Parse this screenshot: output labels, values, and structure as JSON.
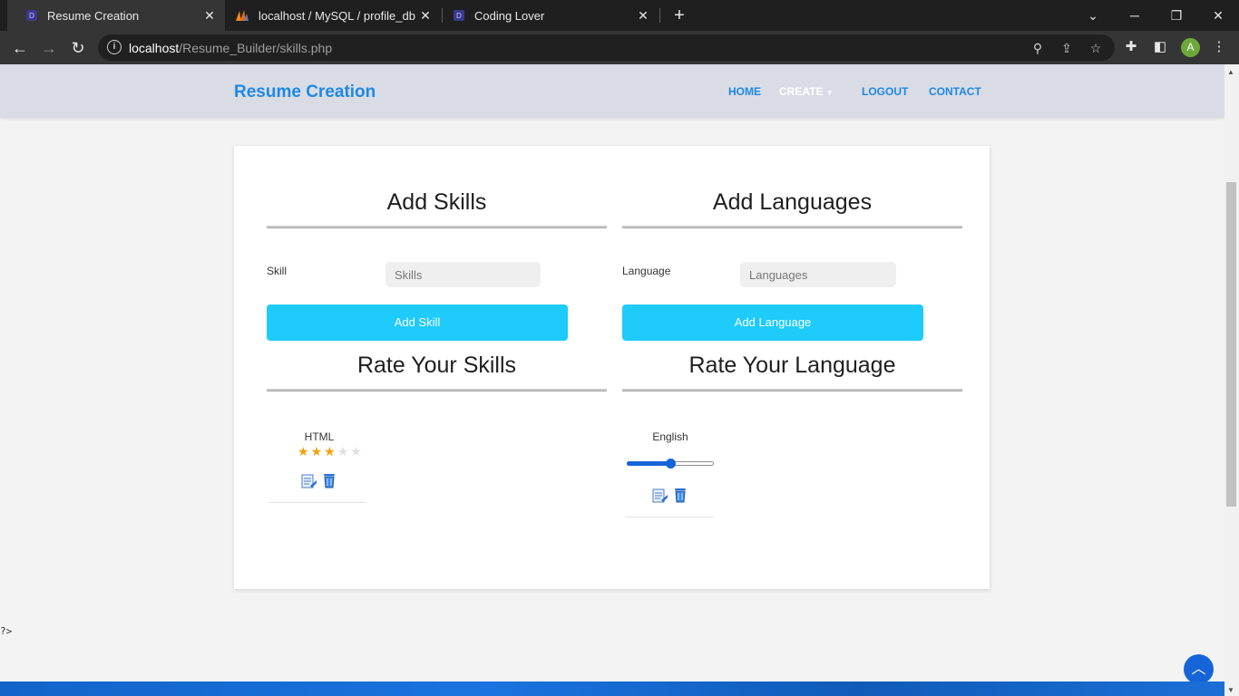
{
  "browser": {
    "tabs": [
      {
        "title": "Resume Creation",
        "active": true,
        "icon": "site-favicon"
      },
      {
        "title": "localhost / MySQL / profile_db / c",
        "active": false,
        "icon": "phpmyadmin-favicon"
      },
      {
        "title": "Coding Lover",
        "active": false,
        "icon": "site-favicon"
      }
    ],
    "address": {
      "host": "localhost",
      "path": "/Resume_Builder/skills.php"
    },
    "avatar_letter": "A"
  },
  "header": {
    "brand": "Resume Creation",
    "nav": {
      "home": "HOME",
      "create": "CREATE",
      "logout": "LOGOUT",
      "contact": "CONTACT"
    }
  },
  "skills": {
    "title": "Add Skills",
    "label": "Skill",
    "placeholder": "Skills",
    "button": "Add Skill",
    "rate_title": "Rate Your Skills",
    "items": [
      {
        "name": "HTML",
        "rating": 3,
        "max": 5
      }
    ]
  },
  "languages": {
    "title": "Add Languages",
    "label": "Language",
    "placeholder": "Languages",
    "button": "Add Language",
    "rate_title": "Rate Your Language",
    "items": [
      {
        "name": "English",
        "level": 0.5
      }
    ]
  },
  "page_tail": "?>",
  "colors": {
    "accent": "#1e88e5",
    "button": "#1ecbfb",
    "star": "#f0a20c"
  }
}
